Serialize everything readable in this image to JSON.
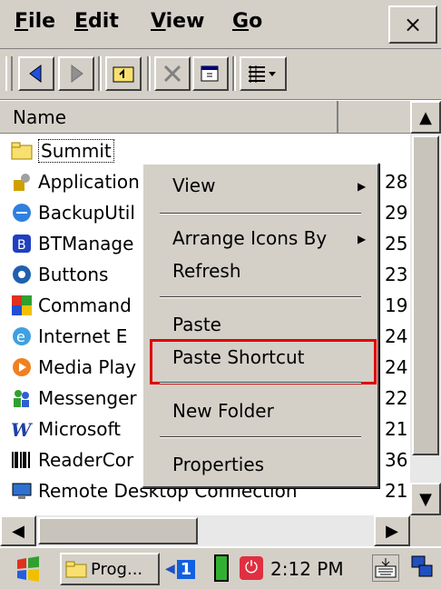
{
  "menubar": {
    "items": [
      {
        "label": "File",
        "accel": "F",
        "rest": "ile"
      },
      {
        "label": "Edit",
        "accel": "E",
        "rest": "dit"
      },
      {
        "label": "View",
        "accel": "V",
        "rest": "iew"
      },
      {
        "label": "Go",
        "accel": "G",
        "rest": "o"
      }
    ],
    "close_label": "×"
  },
  "toolbar": {
    "buttons": [
      "back-icon",
      "forward-icon",
      "up-folder-icon",
      "delete-icon",
      "properties-icon",
      "view-menu-icon"
    ]
  },
  "list": {
    "header_name": "Name",
    "items": [
      {
        "name": "Summit",
        "size": "",
        "icon": "folder-icon"
      },
      {
        "name": "Application",
        "size": "28",
        "icon": "application-icon"
      },
      {
        "name": "BackupUtil",
        "size": "29",
        "icon": "backup-icon"
      },
      {
        "name": "BTManage",
        "size": "25",
        "icon": "bluetooth-icon"
      },
      {
        "name": "Buttons",
        "size": "23",
        "icon": "buttons-icon"
      },
      {
        "name": "Command",
        "size": "19",
        "icon": "command-icon"
      },
      {
        "name": "Internet E",
        "size": "24",
        "icon": "internet-icon"
      },
      {
        "name": "Media Play",
        "size": "24",
        "icon": "media-player-icon"
      },
      {
        "name": "Messenger",
        "size": "22",
        "icon": "messenger-icon"
      },
      {
        "name": "Microsoft",
        "size": "21",
        "icon": "word-icon"
      },
      {
        "name": "ReaderCor",
        "size": "36",
        "icon": "barcode-icon"
      },
      {
        "name": "Remote Desktop Connection",
        "size": "21",
        "icon": "remote-desktop-icon"
      }
    ]
  },
  "context_menu": {
    "view": "View",
    "arrange": "Arrange Icons By",
    "refresh": "Refresh",
    "paste": "Paste",
    "paste_shortcut": "Paste Shortcut",
    "new_folder": "New Folder",
    "properties": "Properties"
  },
  "taskbar": {
    "task_label": "Prog...",
    "connection_count": "1",
    "time": "2:12 PM"
  },
  "colors": {
    "highlight_border": "#e00000",
    "chrome": "#d4d0c8"
  }
}
